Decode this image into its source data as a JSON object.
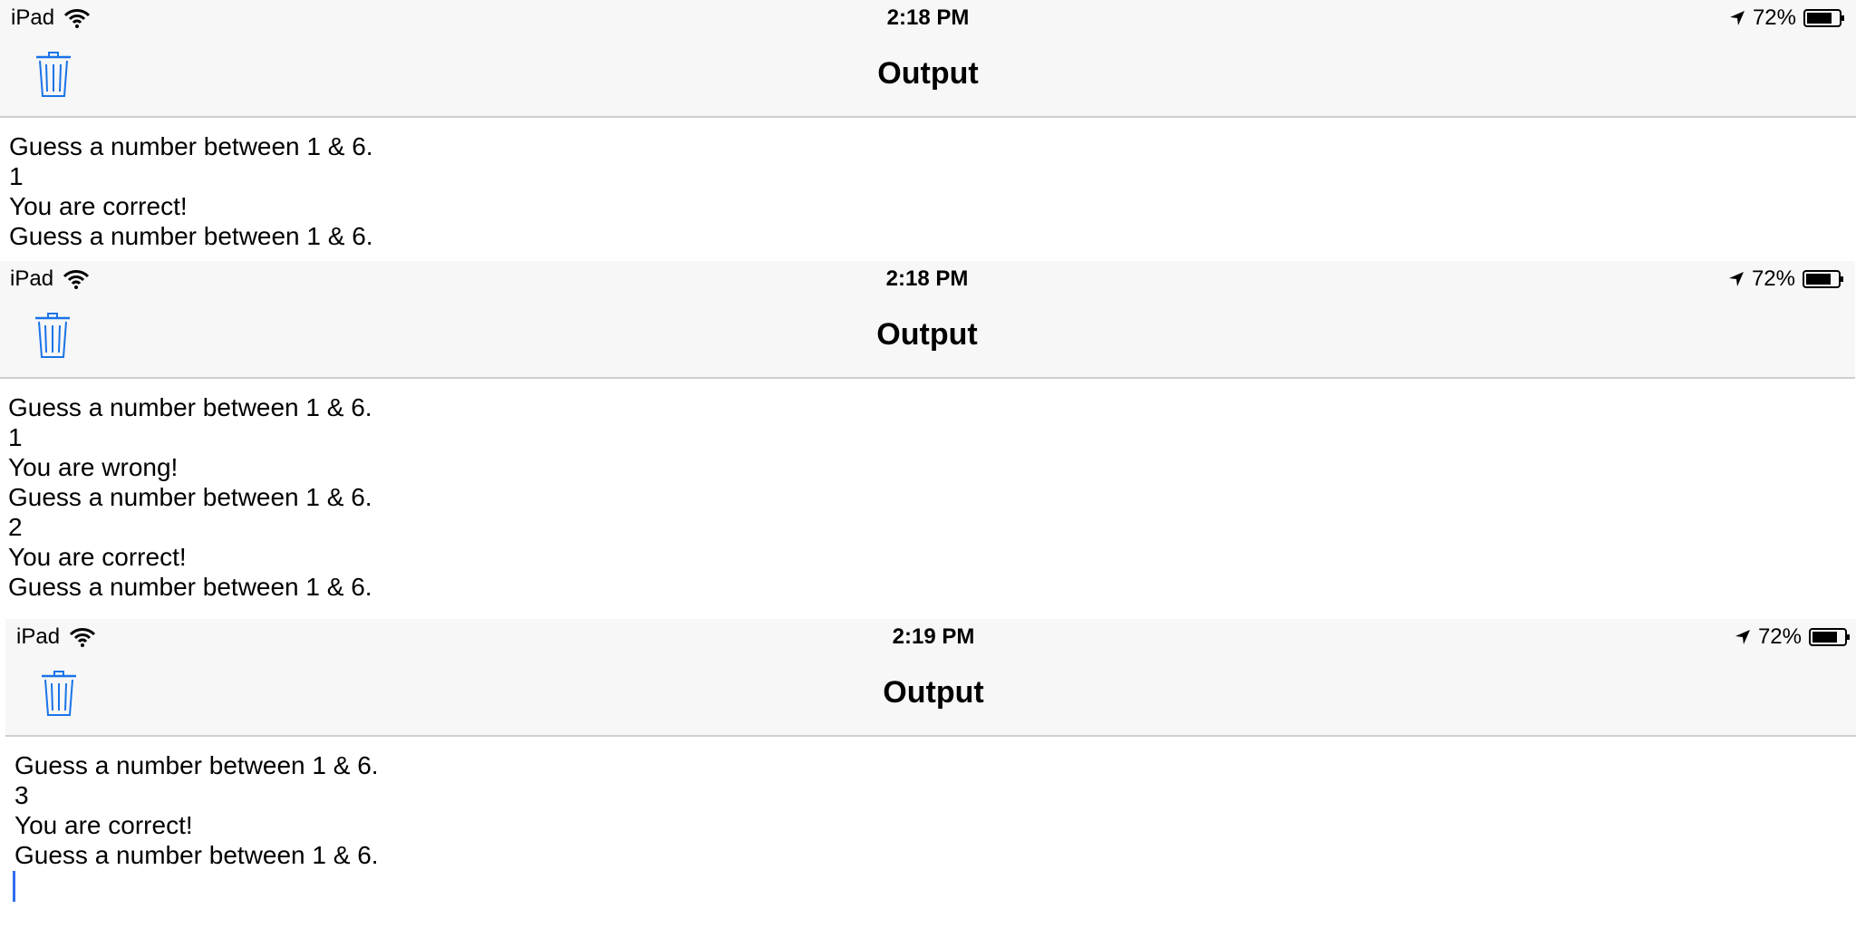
{
  "accent": "#1a73e8",
  "panels": [
    {
      "status": {
        "device": "iPad",
        "time": "2:18 PM",
        "battery": "72%"
      },
      "nav": {
        "title": "Output"
      },
      "lines": [
        "Guess a number between 1 & 6.",
        "1",
        "You are correct!",
        "Guess a number between 1 & 6."
      ]
    },
    {
      "status": {
        "device": "iPad",
        "time": "2:18 PM",
        "battery": "72%"
      },
      "nav": {
        "title": "Output"
      },
      "lines": [
        "Guess a number between 1 & 6.",
        "1",
        "You are wrong!",
        "Guess a number between 1 & 6.",
        "2",
        "You are correct!",
        "Guess a number between 1 & 6."
      ]
    },
    {
      "status": {
        "device": "iPad",
        "time": "2:19 PM",
        "battery": "72%"
      },
      "nav": {
        "title": "Output"
      },
      "lines": [
        "Guess a number between 1 & 6.",
        "3",
        "You are correct!",
        "Guess a number between 1 & 6."
      ]
    }
  ]
}
